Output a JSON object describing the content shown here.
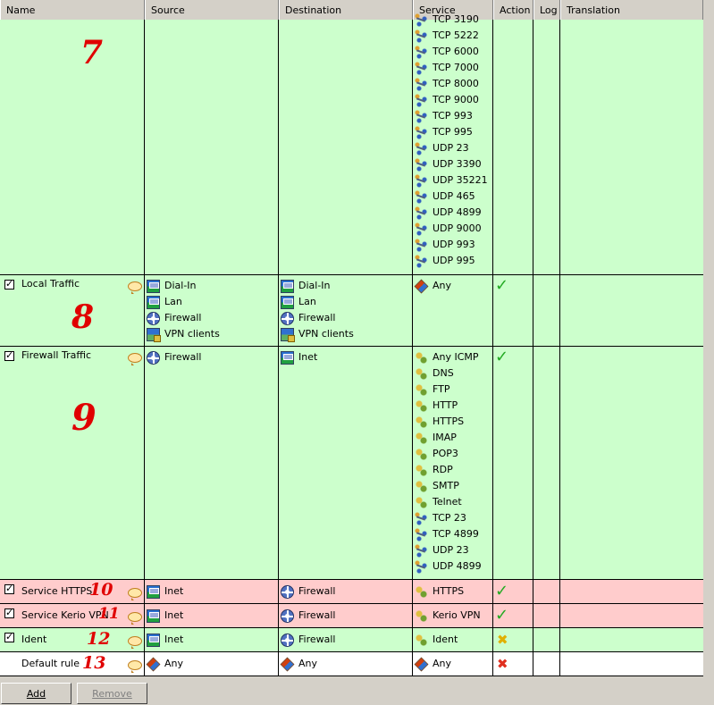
{
  "columns": {
    "name": "Name",
    "source": "Source",
    "destination": "Destination",
    "service": "Service",
    "action": "Action",
    "log": "Log",
    "translation": "Translation"
  },
  "rule7": {
    "annotation": "7",
    "services": [
      "TCP 3190",
      "TCP 5222",
      "TCP 6000",
      "TCP 7000",
      "TCP 8000",
      "TCP 9000",
      "TCP 993",
      "TCP 995",
      "UDP 23",
      "UDP 3390",
      "UDP 35221",
      "UDP 465",
      "UDP 4899",
      "UDP 9000",
      "UDP 993",
      "UDP 995"
    ]
  },
  "rule8": {
    "name": "Local Traffic",
    "annotation": "8",
    "sources": [
      "Dial-In",
      "Lan",
      "Firewall",
      "VPN clients"
    ],
    "destinations": [
      "Dial-In",
      "Lan",
      "Firewall",
      "VPN clients"
    ],
    "service": "Any"
  },
  "rule9": {
    "name": "Firewall Traffic",
    "annotation": "9",
    "source": "Firewall",
    "destination": "Inet",
    "services": [
      "Any ICMP",
      "DNS",
      "FTP",
      "HTTP",
      "HTTPS",
      "IMAP",
      "POP3",
      "RDP",
      "SMTP",
      "Telnet",
      "TCP 23",
      "TCP 4899",
      "UDP 23",
      "UDP 4899"
    ]
  },
  "rule10": {
    "name": "Service HTTPS",
    "annotation": "10",
    "source": "Inet",
    "destination": "Firewall",
    "service": "HTTPS"
  },
  "rule11": {
    "name": "Service Kerio VPN",
    "annotation": "11",
    "source": "Inet",
    "destination": "Firewall",
    "service": "Kerio VPN"
  },
  "rule12": {
    "name": "Ident",
    "annotation": "12",
    "source": "Inet",
    "destination": "Firewall",
    "service": "Ident"
  },
  "rule13": {
    "name": "Default rule",
    "annotation": "13",
    "source": "Any",
    "destination": "Any",
    "service": "Any"
  },
  "buttons": {
    "add": "Add",
    "remove": "Remove"
  },
  "colors": {
    "allowed": "#ccffcc",
    "deny_highlight": "#ffcccc",
    "annotation": "#e00000"
  }
}
